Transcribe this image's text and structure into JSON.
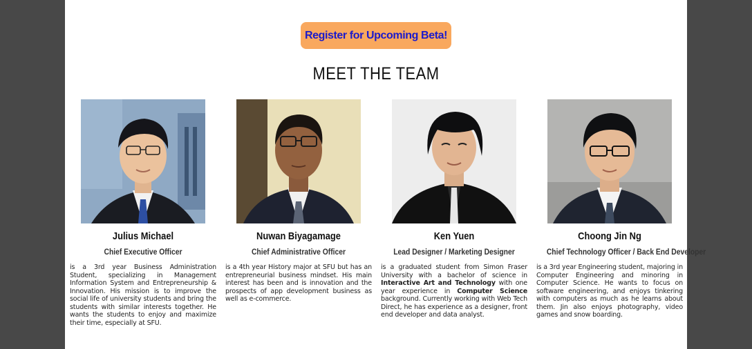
{
  "cta": {
    "label": "Register for Upcoming Beta!"
  },
  "section": {
    "title": "MEET THE TEAM"
  },
  "team": [
    {
      "name": "Julius Michael",
      "role": "Chief Executive Officer",
      "bio": "is a 3rd year Business Administration Student, specializing in Management Information System and Entrepreneurship & Innovation. His mission is to improve the social life of university students and bring the students with similar interests together. He wants the students to enjoy and maximize their time, especially at SFU.",
      "photo_alt": "Photo of Julius Michael"
    },
    {
      "name": "Nuwan Biyagamage",
      "role": "Chief Administrative Officer",
      "bio": "is a 4th year History major at SFU but has an entrepreneurial business mindset. His main interest has been and is innovation and the prospects of app development business as well as e-commerce.",
      "photo_alt": "Photo of Nuwan Biyagamage"
    },
    {
      "name": "Ken Yuen",
      "role": "Lead Designer / Marketing Designer",
      "bio_parts": {
        "p1": "is a graduated student from Simon Fraser University with a bachelor of science in ",
        "b1": "Interactive Art and Technology",
        "p2": " with one year experience in ",
        "b2": "Computer Science",
        "p3": " background. Currently working with Web Tech Direct, he has experience as a designer, front end developer and data analyst."
      },
      "photo_alt": "Photo of Ken Yuen"
    },
    {
      "name": "Choong Jin Ng",
      "role": "Chief Technology Officer / Back End Developer",
      "bio": "is a 3rd year Engineering student, majoring in Computer Engineering and minoring in Computer Science. He wants to focus on software engineering, and enjoys tinkering with computers as much as he learns about them. Jin also enjoys photography, video games and snow boarding.",
      "photo_alt": "Photo of Choong Jin Ng"
    }
  ],
  "colors": {
    "page_bg": "#484848",
    "content_bg": "#ffffff",
    "cta_bg": "#f9a85e",
    "cta_text": "#1a1acc"
  }
}
